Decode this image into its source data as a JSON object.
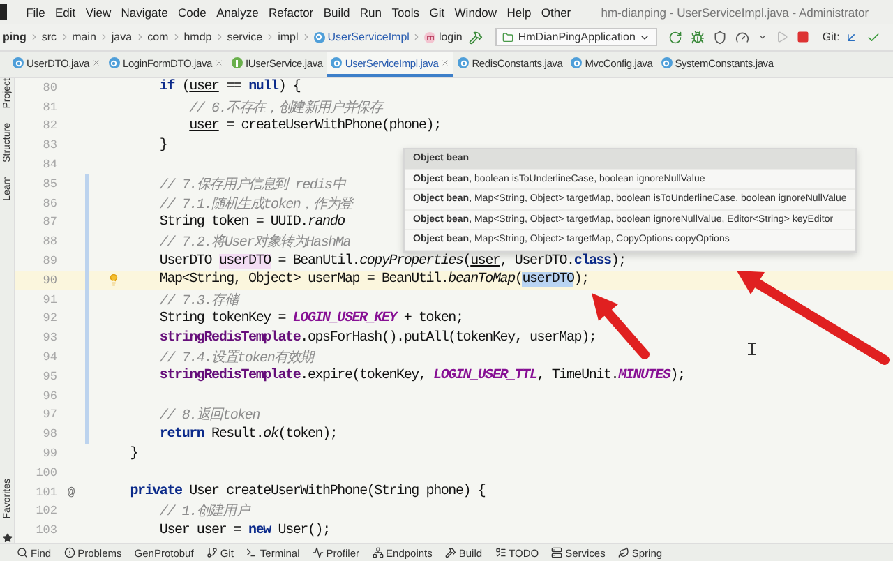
{
  "menu": {
    "items": [
      "File",
      "Edit",
      "View",
      "Navigate",
      "Code",
      "Analyze",
      "Refactor",
      "Build",
      "Run",
      "Tools",
      "Git",
      "Window",
      "Help",
      "Other"
    ],
    "title": "hm-dianping - UserServiceImpl.java - Administrator"
  },
  "breadcrumb": [
    {
      "label": "ping",
      "kind": "folder"
    },
    {
      "label": "src",
      "kind": "folder"
    },
    {
      "label": "main",
      "kind": "folder"
    },
    {
      "label": "java",
      "kind": "folder"
    },
    {
      "label": "com",
      "kind": "folder"
    },
    {
      "label": "hmdp",
      "kind": "folder"
    },
    {
      "label": "service",
      "kind": "folder"
    },
    {
      "label": "impl",
      "kind": "folder"
    },
    {
      "label": "UserServiceImpl",
      "kind": "class"
    },
    {
      "label": "login",
      "kind": "method"
    }
  ],
  "run_config": "HmDianPingApplication",
  "git_label": "Git:",
  "tabs": [
    {
      "label": "UserDTO.java",
      "kind": "class",
      "selected": false,
      "closable": true
    },
    {
      "label": "LoginFormDTO.java",
      "kind": "class",
      "selected": false,
      "closable": true
    },
    {
      "label": "IUserService.java",
      "kind": "interface",
      "selected": false,
      "closable": false
    },
    {
      "label": "UserServiceImpl.java",
      "kind": "class",
      "selected": true,
      "closable": true
    },
    {
      "label": "RedisConstants.java",
      "kind": "class",
      "selected": false,
      "closable": false
    },
    {
      "label": "MvcConfig.java",
      "kind": "class",
      "selected": false,
      "closable": false
    },
    {
      "label": "SystemConstants.java",
      "kind": "class",
      "selected": false,
      "closable": false
    }
  ],
  "side_tools": {
    "top": [
      "Project",
      "Structure",
      "Learn"
    ],
    "bottom": [
      "Favorites"
    ]
  },
  "lines": [
    {
      "number": "80",
      "current": false,
      "code": [
        {
          "t": "        if",
          "kind": "keyword"
        },
        {
          "t": " (",
          "kind": "plain"
        },
        {
          "t": "user",
          "kind": "underline"
        },
        {
          "t": " == ",
          "kind": "plain"
        },
        {
          "t": "null",
          "kind": "keyword"
        },
        {
          "t": ") {",
          "kind": "plain"
        }
      ]
    },
    {
      "number": "81",
      "current": false,
      "code": [
        {
          "t": "            // 6.不存在，创建新用户并保存",
          "kind": "comment"
        }
      ]
    },
    {
      "number": "82",
      "current": false,
      "code": [
        {
          "t": "            user",
          "kind": "underline"
        },
        {
          "t": " = createUserWithPhone(phone);",
          "kind": "plain"
        }
      ]
    },
    {
      "number": "83",
      "current": false,
      "code": [
        {
          "t": "        }",
          "kind": "plain"
        }
      ]
    },
    {
      "number": "84",
      "current": false
    },
    {
      "number": "85",
      "current": false,
      "code": [
        {
          "t": "        // 7.保存用户信息到 redis中",
          "kind": "comment"
        }
      ]
    },
    {
      "number": "86",
      "current": false,
      "code": [
        {
          "t": "        // 7.1.随机生成token，作为登",
          "kind": "comment"
        }
      ]
    },
    {
      "number": "87",
      "current": false,
      "code": [
        {
          "t": "        String token = UUID.",
          "kind": "plain"
        },
        {
          "t": "rando",
          "kind": "static"
        }
      ]
    },
    {
      "number": "88",
      "current": false,
      "code": [
        {
          "t": "        // 7.2.将User对象转为HashMa",
          "kind": "comment"
        }
      ]
    },
    {
      "number": "89",
      "current": false,
      "code": [
        {
          "t": "        UserDTO ",
          "kind": "plain"
        },
        {
          "t": "userDTO",
          "kind": "mark"
        },
        {
          "t": " = BeanUtil.",
          "kind": "plain"
        },
        {
          "t": "copyProperties",
          "kind": "static"
        },
        {
          "t": "(",
          "kind": "plain"
        },
        {
          "t": "user",
          "kind": "underline"
        },
        {
          "t": ", UserDTO.",
          "kind": "plain"
        },
        {
          "t": "class",
          "kind": "keyword"
        },
        {
          "t": ");",
          "kind": "plain"
        }
      ]
    },
    {
      "number": "90",
      "current": true,
      "bulb": true,
      "code": [
        {
          "t": "        Map<String, Object> userMap = BeanUtil.",
          "kind": "plain"
        },
        {
          "t": "beanToMap",
          "kind": "static"
        },
        {
          "t": "(",
          "kind": "plain"
        },
        {
          "t": "userDTO",
          "kind": "selection"
        },
        {
          "t": ");",
          "kind": "plain"
        }
      ]
    },
    {
      "number": "91",
      "current": false,
      "code": [
        {
          "t": "        // 7.3.存储",
          "kind": "comment"
        }
      ]
    },
    {
      "number": "92",
      "current": false,
      "code": [
        {
          "t": "        String tokenKey = ",
          "kind": "plain"
        },
        {
          "t": "LOGIN_USER_KEY",
          "kind": "constant"
        },
        {
          "t": " + token;",
          "kind": "plain"
        }
      ]
    },
    {
      "number": "93",
      "current": false,
      "code": [
        {
          "t": "        stringRedisTemplate",
          "kind": "field"
        },
        {
          "t": ".opsForHash().putAll(tokenKey, userMap);",
          "kind": "plain"
        }
      ]
    },
    {
      "number": "94",
      "current": false,
      "code": [
        {
          "t": "        // 7.4.设置token有效期",
          "kind": "comment"
        }
      ]
    },
    {
      "number": "95",
      "current": false,
      "code": [
        {
          "t": "        stringRedisTemplate",
          "kind": "field"
        },
        {
          "t": ".expire(tokenKey, ",
          "kind": "plain"
        },
        {
          "t": "LOGIN_USER_TTL",
          "kind": "constant"
        },
        {
          "t": ", TimeUnit.",
          "kind": "plain"
        },
        {
          "t": "MINUTES",
          "kind": "constant"
        },
        {
          "t": ");",
          "kind": "plain"
        }
      ]
    },
    {
      "number": "96",
      "current": false
    },
    {
      "number": "97",
      "current": false,
      "code": [
        {
          "t": "        // 8.返回token",
          "kind": "comment"
        }
      ]
    },
    {
      "number": "98",
      "current": false,
      "code": [
        {
          "t": "        return",
          "kind": "keyword"
        },
        {
          "t": " Result.",
          "kind": "plain"
        },
        {
          "t": "ok",
          "kind": "static"
        },
        {
          "t": "(token);",
          "kind": "plain"
        }
      ]
    },
    {
      "number": "99",
      "current": false,
      "code": [
        {
          "t": "    }",
          "kind": "plain"
        }
      ]
    },
    {
      "number": "100",
      "current": false
    },
    {
      "number": "101",
      "current": false,
      "gutter_mark": "@",
      "code": [
        {
          "t": "    private",
          "kind": "keyword"
        },
        {
          "t": " User createUserWithPhone(String phone) {",
          "kind": "plain"
        }
      ]
    },
    {
      "number": "102",
      "current": false,
      "code": [
        {
          "t": "        // 1.创建用户",
          "kind": "comment"
        }
      ]
    },
    {
      "number": "103",
      "current": false,
      "code": [
        {
          "t": "        User user = ",
          "kind": "plain"
        },
        {
          "t": "new",
          "kind": "keyword"
        },
        {
          "t": " User();",
          "kind": "plain"
        }
      ]
    }
  ],
  "popup": [
    {
      "bold": "Object bean",
      "selected": true
    },
    {
      "bold": "Object bean",
      "rest": ", boolean isToUnderlineCase, boolean ignoreNullValue",
      "selected": false
    },
    {
      "bold": "Object bean",
      "rest": ", Map<String, Object> targetMap, boolean isToUnderlineCase, boolean ignoreNullValue",
      "selected": false
    },
    {
      "bold": "Object bean",
      "rest": ", Map<String, Object> targetMap, boolean ignoreNullValue, Editor<String> keyEditor",
      "selected": false
    },
    {
      "bold": "Object bean",
      "rest": ", Map<String, Object> targetMap, CopyOptions copyOptions",
      "selected": false
    }
  ],
  "bottom_tools": [
    {
      "label": "Find",
      "kind": "search"
    },
    {
      "label": "Problems",
      "kind": "problems"
    },
    {
      "label": "GenProtobuf",
      "kind": "none"
    },
    {
      "label": "Git",
      "kind": "git"
    },
    {
      "label": "Terminal",
      "kind": "terminal"
    },
    {
      "label": "Profiler",
      "kind": "profiler"
    },
    {
      "label": "Endpoints",
      "kind": "endpoints"
    },
    {
      "label": "Build",
      "kind": "build"
    },
    {
      "label": "TODO",
      "kind": "todo"
    },
    {
      "label": "Services",
      "kind": "services"
    },
    {
      "label": "Spring",
      "kind": "spring"
    }
  ]
}
